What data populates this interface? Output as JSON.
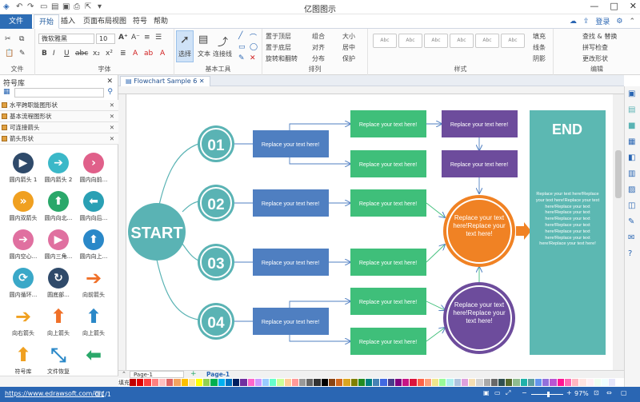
{
  "titlebar": {
    "app_title": "亿图图示",
    "window_buttons": [
      "—",
      "□",
      "✕"
    ]
  },
  "menubar": {
    "file": "文件",
    "tabs": [
      "开始",
      "插入",
      "页面布局",
      "视图",
      "符号",
      "帮助"
    ],
    "active_tab": "开始",
    "login": "登录"
  },
  "ribbon": {
    "groups": {
      "file": "文件",
      "font": "字体",
      "basic_tools": "基本工具",
      "arrange": "排列",
      "style": "样式",
      "edit": "编辑"
    },
    "font_name": "微软雅黑",
    "font_size": "10",
    "tools": {
      "select": "选择",
      "text": "文本",
      "connector": "连接线"
    },
    "arrange_items": [
      "置于顶层",
      "置于底层",
      "旋转和翻转",
      "组合",
      "对齐",
      "分布",
      "大小",
      "居中",
      "保护"
    ],
    "style_samples": [
      "Abc",
      "Abc",
      "Abc",
      "Abc",
      "Abc",
      "Abc",
      "Abc"
    ],
    "format_items": [
      "填充",
      "线条",
      "阴影"
    ],
    "edit_items": [
      "查找 & 替换",
      "拼写检查",
      "更改形状"
    ]
  },
  "library": {
    "title": "符号库",
    "categories": [
      "水平跨职能图形状",
      "基本流程图形状",
      "可连接箭头",
      "箭头形状"
    ],
    "shapes": [
      {
        "label": "圆内箭头 1",
        "glyph": "▶",
        "color": "#2f4a6a"
      },
      {
        "label": "圆内箭头 2",
        "glyph": "➔",
        "color": "#3bb8c8"
      },
      {
        "label": "圆内向前...",
        "glyph": "›",
        "color": "#e0608a"
      },
      {
        "label": "圆内双箭头",
        "glyph": "»",
        "color": "#f0a020"
      },
      {
        "label": "圆内向北...",
        "glyph": "⬆",
        "color": "#2aa86a"
      },
      {
        "label": "圆内向后...",
        "glyph": "⬅",
        "color": "#2aa0b4"
      },
      {
        "label": "圆内空心...",
        "glyph": "➔",
        "color": "#e070a0"
      },
      {
        "label": "圆内三角...",
        "glyph": "▶",
        "color": "#e070a0"
      },
      {
        "label": "圆内向上...",
        "glyph": "⬆",
        "color": "#2a88c8"
      },
      {
        "label": "圆内循环...",
        "glyph": "⟳",
        "color": "#3aa8c8"
      },
      {
        "label": "圆底部...",
        "glyph": "↻",
        "color": "#2f4a6a"
      },
      {
        "label": "向前箭头",
        "glyph": "➔",
        "color": "#f07028"
      },
      {
        "label": "向右箭头",
        "glyph": "➔",
        "color": "#f0a020"
      },
      {
        "label": "向上箭头",
        "glyph": "⬆",
        "color": "#f07028"
      },
      {
        "label": "向上箭头",
        "glyph": "⬆",
        "color": "#2a88c8"
      },
      {
        "label": "符号库",
        "glyph": "⬆",
        "color": "#f0a020"
      },
      {
        "label": "文件恢复",
        "glyph": "⤡",
        "color": "#2a88c8"
      },
      {
        "label": "",
        "glyph": "⬅",
        "color": "#2aa86a"
      }
    ]
  },
  "document": {
    "tab_title": "Flowchart Sample 6",
    "page_tab": "Page-1",
    "page_tab_active": "Page-1",
    "fill_label": "填充"
  },
  "flowchart": {
    "start": "START",
    "end": "END",
    "numbers": [
      "01",
      "02",
      "03",
      "04"
    ],
    "box_text": "Replace your text here!",
    "circle_text": "Replace your text here!Replace your text here!",
    "end_text": "Replace your text here!Replace your text here!Replace your text here!Replace your text here!Replace your text here!Replace your text here!Replace your text here!Replace your text here!Replace your text here!Replace your text here!",
    "colors": {
      "teal": "#5ab3b4",
      "blue": "#4f7fc1",
      "green": "#3fbf7a",
      "purple": "#6d4c9c",
      "orange": "#f08224",
      "end": "#5cb8b2"
    }
  },
  "status": {
    "url": "https://www.edrawsoft.com/cn/",
    "page": "页1/1",
    "zoom": "97%"
  },
  "palette_colors": [
    "#c00000",
    "#e00000",
    "#ff4040",
    "#ff8080",
    "#ffc0c0",
    "#e06666",
    "#f4a460",
    "#ffc000",
    "#ffe699",
    "#ffff00",
    "#92d050",
    "#00b050",
    "#00b0f0",
    "#0070c0",
    "#002060",
    "#7030a0",
    "#ff66cc",
    "#cc99ff",
    "#99ccff",
    "#66ffcc",
    "#ccff99",
    "#ffcc99",
    "#ff9999",
    "#999999",
    "#666666",
    "#333333",
    "#000000",
    "#8b4513",
    "#d2691e",
    "#daa520",
    "#808000",
    "#228b22",
    "#008080",
    "#4682b4",
    "#4169e1",
    "#483d8b",
    "#800080",
    "#c71585",
    "#dc143c",
    "#ff6347",
    "#ffa07a",
    "#f0e68c",
    "#98fb98",
    "#afeeee",
    "#b0c4de",
    "#dda0dd",
    "#f5deb3",
    "#d3d3d3",
    "#a9a9a9",
    "#696969",
    "#2f4f4f",
    "#556b2f",
    "#8fbc8f",
    "#20b2aa",
    "#5f9ea0",
    "#6495ed",
    "#9370db",
    "#ba55d3",
    "#ff1493",
    "#ff69b4",
    "#ffb6c1",
    "#ffe4e1",
    "#fff0f5",
    "#f0fff0",
    "#f0ffff",
    "#e6e6fa",
    "#ffffff"
  ]
}
